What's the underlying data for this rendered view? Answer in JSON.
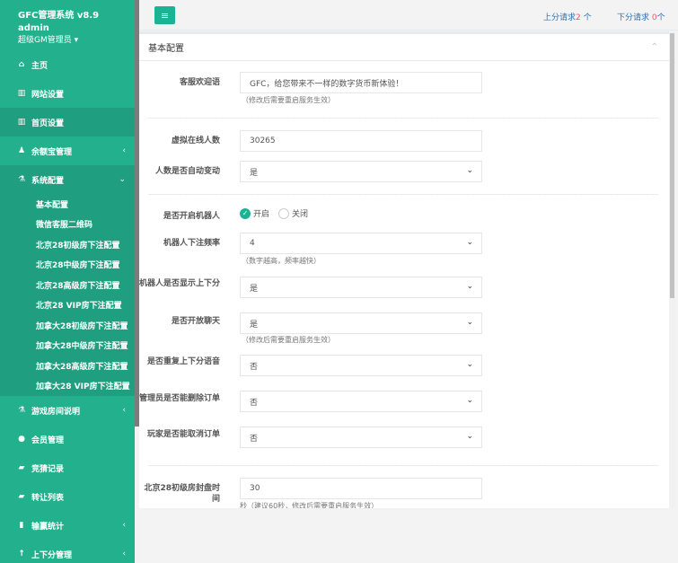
{
  "sidebar": {
    "system_name": "GFC管理系统 v8.9",
    "user": "admin",
    "role": "超级GM管理员",
    "items": [
      {
        "label": "主页",
        "icon": "home-icon",
        "glyph": "⌂"
      },
      {
        "label": "网站设置",
        "icon": "columns-icon",
        "glyph": "▥"
      },
      {
        "label": "首页设置",
        "icon": "columns-icon",
        "glyph": "▥"
      },
      {
        "label": "余额宝管理",
        "icon": "person-icon",
        "glyph": "♟",
        "arrow": "‹"
      },
      {
        "label": "系统配置",
        "icon": "flask-icon",
        "glyph": "⚗",
        "arrow": "⌄"
      }
    ],
    "subitems": [
      "基本配置",
      "微信客服二维码",
      "北京28初级房下注配置",
      "北京28中级房下注配置",
      "北京28高级房下注配置",
      "北京28 VIP房下注配置",
      "加拿大28初级房下注配置",
      "加拿大28中级房下注配置",
      "加拿大28高级房下注配置",
      "加拿大28 VIP房下注配置"
    ],
    "items_after": [
      {
        "label": "游戏房间说明",
        "icon": "flask-icon",
        "glyph": "⚗",
        "arrow": "‹"
      },
      {
        "label": "会员管理",
        "icon": "user-icon",
        "glyph": "●"
      },
      {
        "label": "竞猜记录",
        "icon": "car-icon",
        "glyph": "▰"
      },
      {
        "label": "转让列表",
        "icon": "car-icon",
        "glyph": "▰"
      },
      {
        "label": "输赢统计",
        "icon": "bar-chart-icon",
        "glyph": "▮",
        "arrow": "‹"
      },
      {
        "label": "上下分管理",
        "icon": "arrow-up-icon",
        "glyph": "↑",
        "arrow": "‹"
      }
    ]
  },
  "topbar": {
    "menu_glyph": "≡",
    "up_label": "上分请求",
    "up_count": "2",
    "up_unit": "个",
    "down_label": "下分请求",
    "down_count": "0",
    "down_unit": "个"
  },
  "panel": {
    "title": "基本配置",
    "collapse_glyph": "⌃"
  },
  "form": {
    "welcome_label": "客服欢迎语",
    "welcome_value": "GFC，给您带来不一样的数字货币新体验！",
    "welcome_hint": "（修改后需要重启服务生效）",
    "online_label": "虚拟在线人数",
    "online_value": "30265",
    "auto_change_label": "人数是否自动变动",
    "auto_change_value": "是",
    "robot_label": "是否开启机器人",
    "robot_on": "开启",
    "robot_off": "关闭",
    "robot_freq_label": "机器人下注频率",
    "robot_freq_value": "4",
    "robot_freq_hint": "（数字越高，频率越快）",
    "robot_show_label": "机器人是否显示上下分",
    "robot_show_value": "是",
    "chat_label": "是否开放聊天",
    "chat_value": "是",
    "chat_hint": "（修改后需要重启服务生效）",
    "repeat_voice_label": "是否重复上下分语音",
    "repeat_voice_value": "否",
    "admin_delete_label": "管理员是否能删除订单",
    "admin_delete_value": "否",
    "player_cancel_label": "玩家是否能取消订单",
    "player_cancel_value": "否",
    "bj28_close_label": "北京28初级房封盘时间",
    "bj28_close_value": "30",
    "bj28_close_hint": "秒（建议60秒，修改后需要重启服务生效）"
  }
}
